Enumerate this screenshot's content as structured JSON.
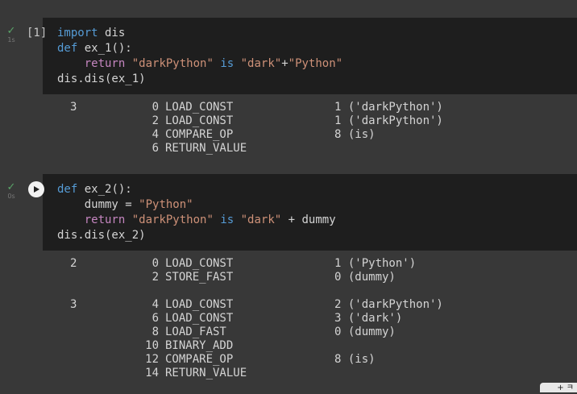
{
  "cells": [
    {
      "exec_count": "[1]",
      "exec_time": "1s",
      "status": "check-icon",
      "code_lines": [
        [
          {
            "t": "import",
            "c": "kw"
          },
          {
            "t": " dis",
            "c": ""
          }
        ],
        [
          {
            "t": "def",
            "c": "kw"
          },
          {
            "t": " ex_1():",
            "c": ""
          }
        ],
        [
          {
            "t": "    ",
            "c": ""
          },
          {
            "t": "return",
            "c": "kwc"
          },
          {
            "t": " ",
            "c": ""
          },
          {
            "t": "\"darkPython\"",
            "c": "str"
          },
          {
            "t": " ",
            "c": ""
          },
          {
            "t": "is",
            "c": "kw"
          },
          {
            "t": " ",
            "c": ""
          },
          {
            "t": "\"dark\"",
            "c": "str"
          },
          {
            "t": "+",
            "c": ""
          },
          {
            "t": "\"Python\"",
            "c": "str"
          }
        ],
        [
          {
            "t": "dis.dis(ex_1)",
            "c": ""
          }
        ]
      ],
      "output": [
        {
          "lineno": "3",
          "offset": "0",
          "op": "LOAD_CONST",
          "arg": "1 ('darkPython')"
        },
        {
          "lineno": "",
          "offset": "2",
          "op": "LOAD_CONST",
          "arg": "1 ('darkPython')"
        },
        {
          "lineno": "",
          "offset": "4",
          "op": "COMPARE_OP",
          "arg": "8 (is)"
        },
        {
          "lineno": "",
          "offset": "6",
          "op": "RETURN_VALUE",
          "arg": ""
        }
      ]
    },
    {
      "exec_count": "",
      "exec_time": "0s",
      "status": "check-icon",
      "code_lines": [
        [
          {
            "t": "def",
            "c": "kw"
          },
          {
            "t": " ex_2():",
            "c": ""
          }
        ],
        [
          {
            "t": "    dummy = ",
            "c": ""
          },
          {
            "t": "\"Python\"",
            "c": "str"
          }
        ],
        [
          {
            "t": "    ",
            "c": ""
          },
          {
            "t": "return",
            "c": "kwc"
          },
          {
            "t": " ",
            "c": ""
          },
          {
            "t": "\"darkPython\"",
            "c": "str"
          },
          {
            "t": " ",
            "c": ""
          },
          {
            "t": "is",
            "c": "kw"
          },
          {
            "t": " ",
            "c": ""
          },
          {
            "t": "\"dark\"",
            "c": "str"
          },
          {
            "t": " + dummy",
            "c": ""
          }
        ],
        [
          {
            "t": "dis.dis(ex_2)",
            "c": ""
          }
        ]
      ],
      "output": [
        {
          "lineno": "2",
          "offset": "0",
          "op": "LOAD_CONST",
          "arg": "1 ('Python')"
        },
        {
          "lineno": "",
          "offset": "2",
          "op": "STORE_FAST",
          "arg": "0 (dummy)"
        },
        {
          "lineno": "",
          "offset": "",
          "op": "",
          "arg": ""
        },
        {
          "lineno": "3",
          "offset": "4",
          "op": "LOAD_CONST",
          "arg": "2 ('darkPython')"
        },
        {
          "lineno": "",
          "offset": "6",
          "op": "LOAD_CONST",
          "arg": "3 ('dark')"
        },
        {
          "lineno": "",
          "offset": "8",
          "op": "LOAD_FAST",
          "arg": "0 (dummy)"
        },
        {
          "lineno": "",
          "offset": "10",
          "op": "BINARY_ADD",
          "arg": ""
        },
        {
          "lineno": "",
          "offset": "12",
          "op": "COMPARE_OP",
          "arg": "8 (is)"
        },
        {
          "lineno": "",
          "offset": "14",
          "op": "RETURN_VALUE",
          "arg": ""
        }
      ]
    }
  ],
  "corner_tab": {
    "label": "+ ㅋ"
  },
  "colors": {
    "background": "#383838",
    "code_bg": "#1e1e1e",
    "keyword": "#569cd6",
    "control_keyword": "#c586c0",
    "string": "#ce9178",
    "success": "#5aa469"
  }
}
